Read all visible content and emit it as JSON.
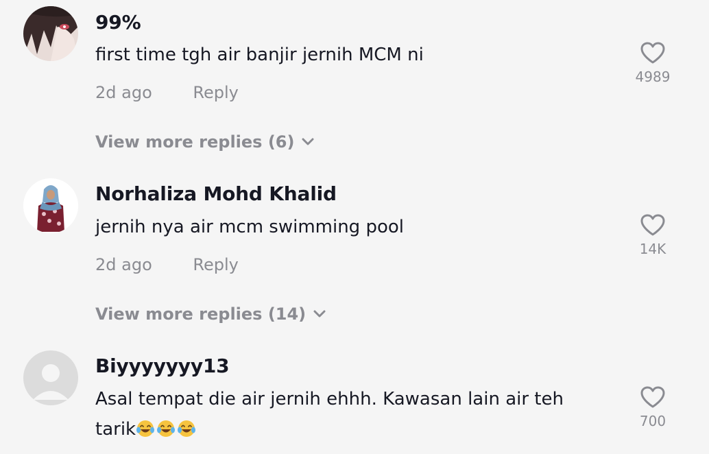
{
  "comments": [
    {
      "username": "99%",
      "text": "first time tgh air banjir jernih MCM ni",
      "time": "2d ago",
      "reply_label": "Reply",
      "likes": "4989",
      "more_replies": "View more replies (6)",
      "avatar": "dark-haired-anime-avatar"
    },
    {
      "username": "Norhaliza Mohd Khalid",
      "text": "jernih nya air mcm swimming pool",
      "time": "2d ago",
      "reply_label": "Reply",
      "likes": "14K",
      "more_replies": "View more replies (14)",
      "avatar": "woman-in-hijab-avatar"
    },
    {
      "username": "Biyyyyyyy13",
      "text_line1": "Asal tempat die air jernih ehhh. Kawasan lain air teh",
      "text_line2": "tarik",
      "emojis": [
        "face-with-tears-of-joy",
        "face-with-tears-of-joy",
        "face-with-tears-of-joy"
      ],
      "likes": "700",
      "avatar": "default-user-avatar"
    }
  ],
  "colors": {
    "background": "#f5f5f5",
    "primary_text": "#161823",
    "secondary_text": "#8a8b91"
  }
}
